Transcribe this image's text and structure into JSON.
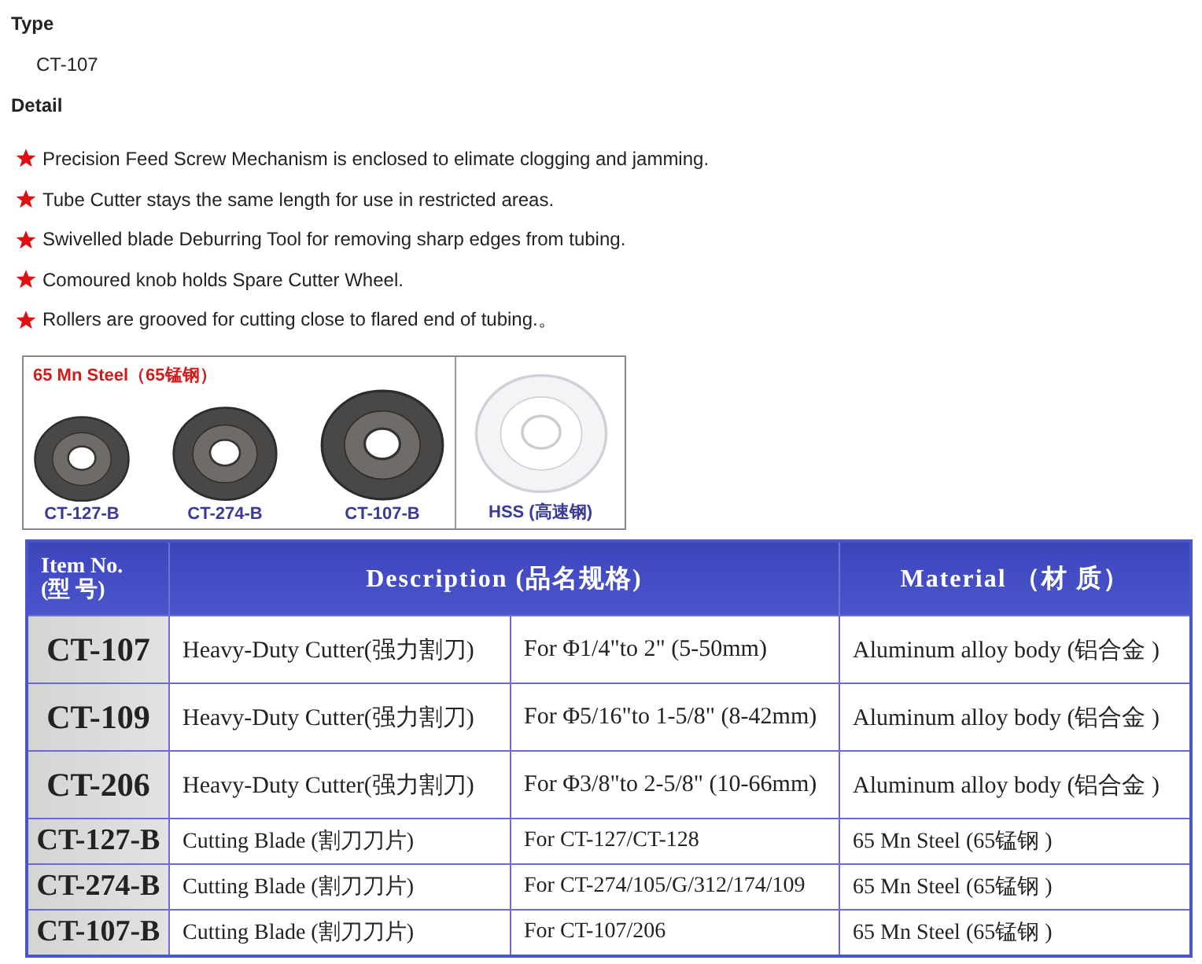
{
  "type_section": {
    "heading": "Type",
    "value": "CT-107"
  },
  "detail": {
    "heading": "Detail",
    "bullets": [
      "Precision Feed Screw Mechanism is enclosed to elimate clogging and jamming.",
      "Tube Cutter stays the same length for use in restricted areas.",
      "Swivelled blade Deburring Tool for removing sharp edges from tubing.",
      "Comoured knob holds Spare Cutter Wheel.",
      "Rollers are grooved for cutting close to flared end of tubing.。"
    ]
  },
  "blades": {
    "title": "65 Mn Steel（65锰钢）",
    "steel": [
      {
        "label": "CT-127-B"
      },
      {
        "label": "CT-274-B"
      },
      {
        "label": "CT-107-B"
      }
    ],
    "hss": {
      "label": "HSS (高速钢)"
    }
  },
  "table": {
    "columns": [
      {
        "lines": [
          "Item No.",
          "(型 号)"
        ]
      },
      {
        "lines": [
          "Description (品名规格)"
        ]
      },
      {
        "lines": [
          "Material （材 质）"
        ]
      }
    ],
    "rows": [
      {
        "kind": "cutter",
        "item": "CT-107",
        "name": "Heavy-Duty Cutter(强力割刀)",
        "spec": "For Φ1/4\"to 2\" (5-50mm)",
        "material": "Aluminum alloy body (铝合金 )"
      },
      {
        "kind": "cutter",
        "item": "CT-109",
        "name": "Heavy-Duty Cutter(强力割刀)",
        "spec": "For Φ5/16\"to 1-5/8\" (8-42mm)",
        "material": "Aluminum alloy body (铝合金 )"
      },
      {
        "kind": "cutter",
        "item": "CT-206",
        "name": "Heavy-Duty Cutter(强力割刀)",
        "spec": "For Φ3/8\"to 2-5/8\" (10-66mm)",
        "material": "Aluminum alloy body (铝合金 )"
      },
      {
        "kind": "blade",
        "item": "CT-127-B",
        "name": "Cutting Blade (割刀刀片)",
        "spec": "For CT-127/CT-128",
        "material": "65 Mn Steel (65锰钢 )"
      },
      {
        "kind": "blade",
        "item": "CT-274-B",
        "name": "Cutting Blade (割刀刀片)",
        "spec": "For CT-274/105/G/312/174/109",
        "material": "65 Mn Steel (65锰钢 )"
      },
      {
        "kind": "blade",
        "item": "CT-107-B",
        "name": "Cutting Blade (割刀刀片)",
        "spec": "For CT-107/206",
        "material": "65 Mn Steel (65锰钢 )"
      }
    ]
  }
}
